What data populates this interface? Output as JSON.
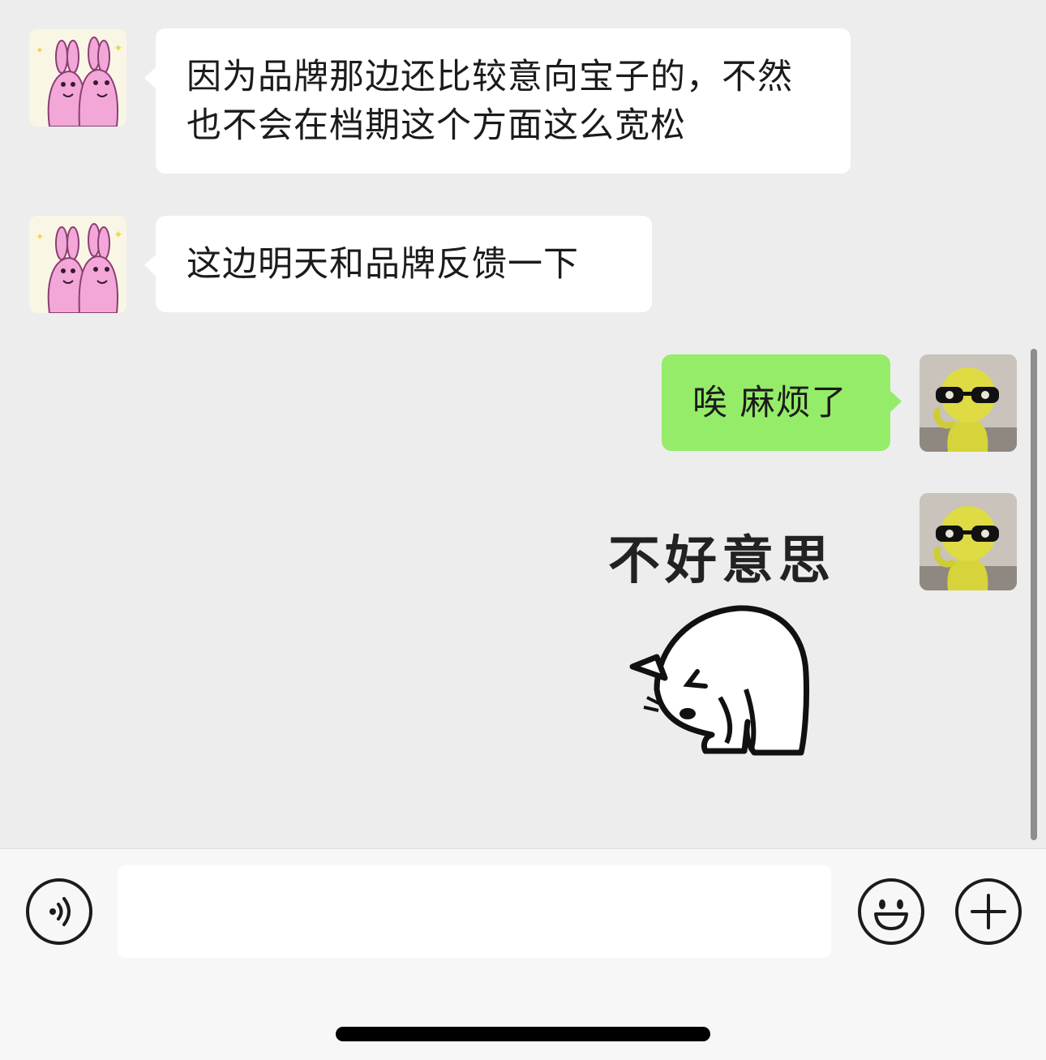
{
  "messages": [
    {
      "side": "left",
      "type": "text",
      "avatar": "pink-rabbits-avatar",
      "text": "因为品牌那边还比较意向宝子的，不然也不会在档期这个方面这么宽松"
    },
    {
      "side": "left",
      "type": "text",
      "avatar": "pink-rabbits-avatar",
      "text": "这边明天和品牌反馈一下"
    },
    {
      "side": "right",
      "type": "text",
      "avatar": "yellow-figure-glasses-avatar",
      "text": "唉 麻烦了"
    },
    {
      "side": "right",
      "type": "sticker",
      "avatar": "yellow-figure-glasses-avatar",
      "sticker_text": "不好意思",
      "sticker_icon": "bowing-cat-sticker"
    }
  ],
  "input_bar": {
    "voice_icon": "voice-icon",
    "text_value": "",
    "emoji_icon": "emoji-icon",
    "plus_icon": "plus-icon"
  },
  "colors": {
    "chat_background": "#ededed",
    "incoming_bubble": "#ffffff",
    "outgoing_bubble": "#95ec69",
    "input_bar_background": "#f7f7f7"
  }
}
